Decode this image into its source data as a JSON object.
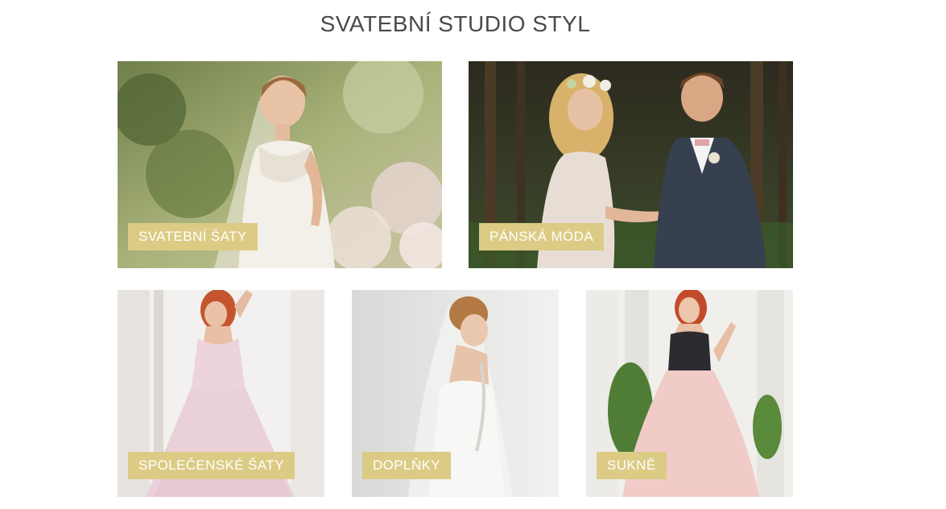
{
  "page": {
    "title": "SVATEBNÍ STUDIO STYL"
  },
  "colors": {
    "label_bg": "#dccb84",
    "label_text": "#ffffff",
    "title": "#4a4a4a"
  },
  "tiles": [
    {
      "label": "SVATEBNÍ ŠATY"
    },
    {
      "label": "PÁNSKÁ MÓDA"
    },
    {
      "label": "SPOLEČENSKÉ ŠATY"
    },
    {
      "label": "DOPLŇKY"
    },
    {
      "label": "SUKNĚ"
    }
  ]
}
